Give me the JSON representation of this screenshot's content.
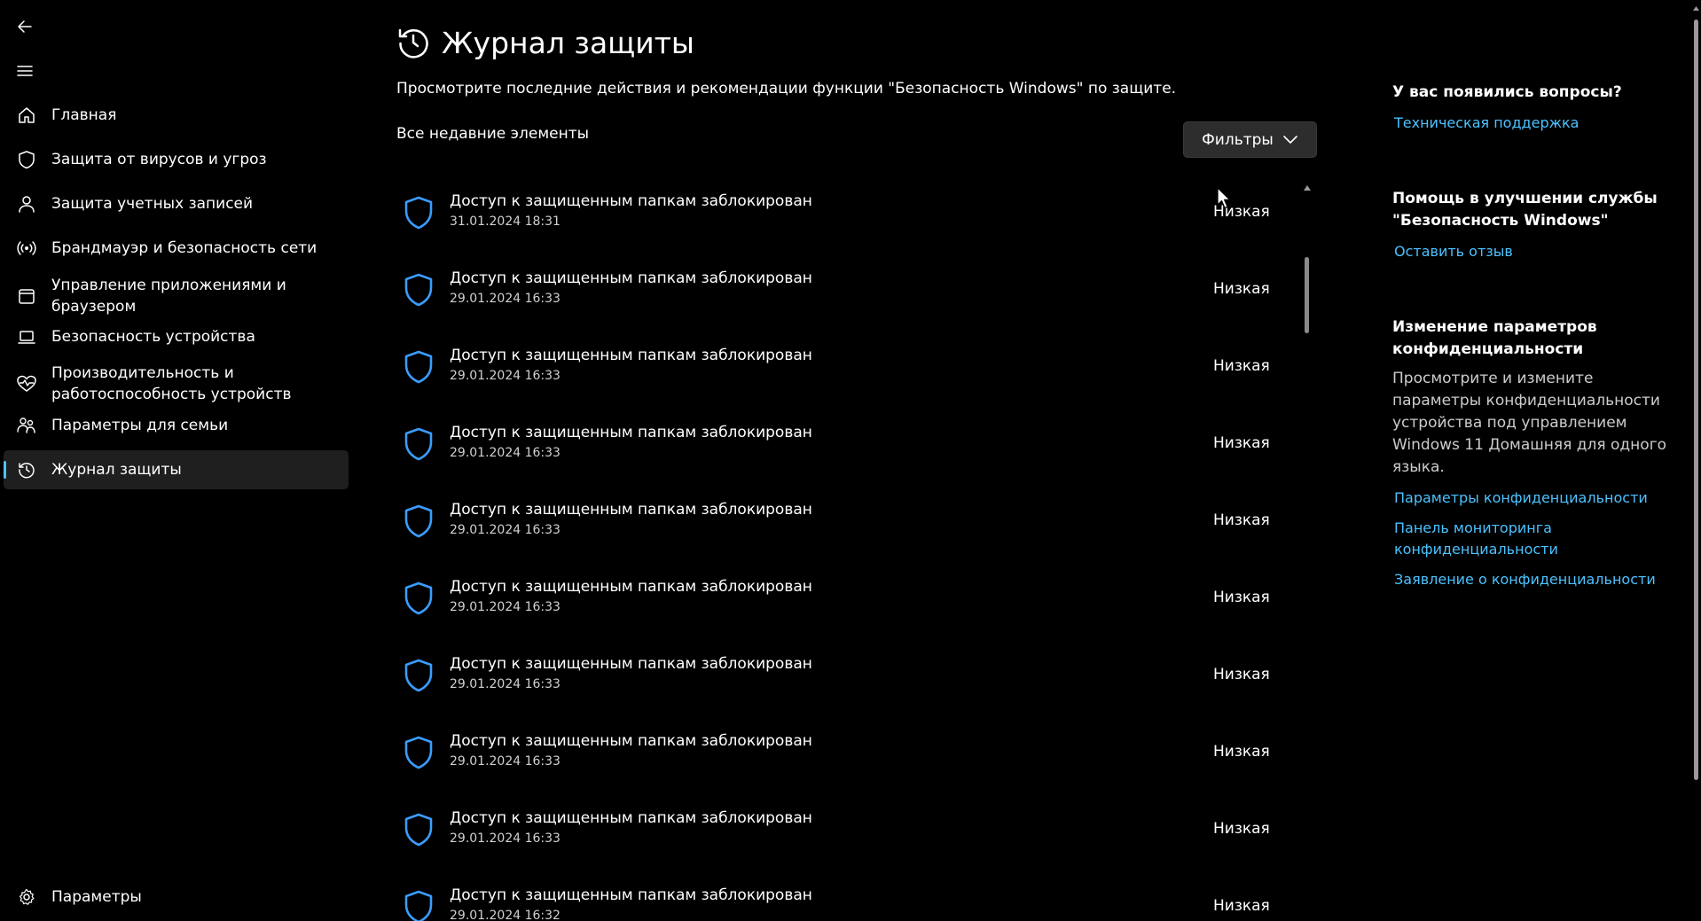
{
  "nav": {
    "items": [
      {
        "label": "Главная",
        "icon": "home-icon"
      },
      {
        "label": "Защита от вирусов и угроз",
        "icon": "shield-icon"
      },
      {
        "label": "Защита учетных записей",
        "icon": "person-icon"
      },
      {
        "label": "Брандмауэр и безопасность сети",
        "icon": "wireless-icon"
      },
      {
        "label": "Управление приложениями и браузером",
        "icon": "app-window-icon"
      },
      {
        "label": "Безопасность устройства",
        "icon": "laptop-icon"
      },
      {
        "label": "Производительность и работоспособность устройств",
        "icon": "heart-pulse-icon"
      },
      {
        "label": "Параметры для семьи",
        "icon": "family-icon"
      },
      {
        "label": "Журнал защиты",
        "icon": "history-icon",
        "selected": true
      }
    ],
    "settings_label": "Параметры"
  },
  "main": {
    "title": "Журнал защиты",
    "description": "Просмотрите последние действия и рекомендации функции \"Безопасность Windows\" по защите.",
    "section_title": "Все недавние элементы",
    "filters_label": "Фильтры",
    "items": [
      {
        "title": "Доступ к защищенным папкам заблокирован",
        "date": "31.01.2024 18:31",
        "level": "Низкая"
      },
      {
        "title": "Доступ к защищенным папкам заблокирован",
        "date": "29.01.2024 16:33",
        "level": "Низкая"
      },
      {
        "title": "Доступ к защищенным папкам заблокирован",
        "date": "29.01.2024 16:33",
        "level": "Низкая"
      },
      {
        "title": "Доступ к защищенным папкам заблокирован",
        "date": "29.01.2024 16:33",
        "level": "Низкая"
      },
      {
        "title": "Доступ к защищенным папкам заблокирован",
        "date": "29.01.2024 16:33",
        "level": "Низкая"
      },
      {
        "title": "Доступ к защищенным папкам заблокирован",
        "date": "29.01.2024 16:33",
        "level": "Низкая"
      },
      {
        "title": "Доступ к защищенным папкам заблокирован",
        "date": "29.01.2024 16:33",
        "level": "Низкая"
      },
      {
        "title": "Доступ к защищенным папкам заблокирован",
        "date": "29.01.2024 16:33",
        "level": "Низкая"
      },
      {
        "title": "Доступ к защищенным папкам заблокирован",
        "date": "29.01.2024 16:33",
        "level": "Низкая"
      },
      {
        "title": "Доступ к защищенным папкам заблокирован",
        "date": "29.01.2024 16:32",
        "level": "Низкая"
      }
    ]
  },
  "right": {
    "questions_heading": "У вас появились вопросы?",
    "support_link": "Техническая поддержка",
    "improve_heading": "Помощь в улучшении службы \"Безопасность Windows\"",
    "feedback_link": "Оставить отзыв",
    "privacy_heading": "Изменение параметров конфиденциальности",
    "privacy_text": "Просмотрите и измените параметры конфиденциальности устройства под управлением Windows 11 Домашняя для одного языка.",
    "privacy_links": [
      "Параметры конфиденциальности",
      "Панель мониторинга конфиденциальности",
      "Заявление о конфиденциальности"
    ]
  },
  "colors": {
    "background": "#000000",
    "accent": "#4cc2ff",
    "shield": "#3b9cff",
    "selected_bg": "#1f1f1f"
  }
}
